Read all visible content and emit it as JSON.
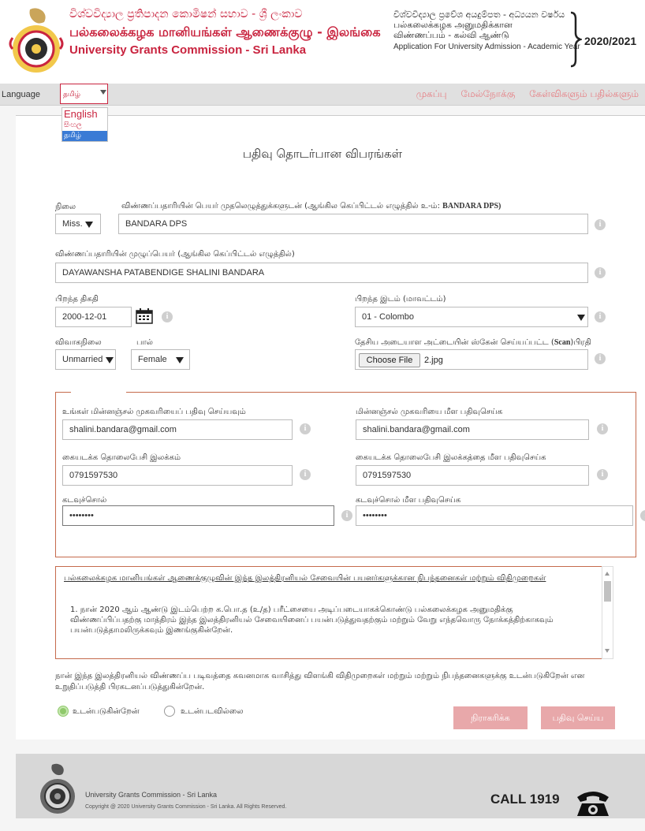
{
  "header": {
    "title_si": "විශ්වවිද්‍යාල ප්‍රතිපාදන කොමිෂන් සභාව - ශ්‍රී ලංකාව",
    "title_ta": "பல்கலைக்கழக மானியங்கள் ஆணைக்குழு - இலங்கை",
    "title_en": "University Grants Commission - Sri Lanka",
    "app_si": "විශ්වවිද්‍යාල ප්‍රවේශ අයදුම්පත - අධ්‍යයන වර්ෂය",
    "app_ta_1": "பல்கலைக்கழக அனுமதிக்கான",
    "app_ta_2": "விண்ணப்பம் - கல்வி ஆண்டு",
    "app_en": "Application For University Admission - Academic Year",
    "year": "2020/2021"
  },
  "nav": {
    "language_label": "Language",
    "language_selected": "தமிழ்",
    "language_options": [
      "English",
      "සිංහල",
      "தமிழ்"
    ],
    "links": [
      "முகப்பு",
      "மேல்நோக்கு",
      "கேள்விகளும் பதில்களும்"
    ]
  },
  "form": {
    "page_title": "பதிவு தொடர்பான விபரங்கள்",
    "title_label": "நிலை",
    "title_value": "Miss.",
    "name_initials_label": "விண்ணப்பதாரியின் பெயர் முதலெழுத்துக்களுடன் (ஆங்கில கெப்பிட்டல் எழுத்தில் உ-ம்:",
    "name_initials_example": "BANDARA DPS)",
    "name_initials_value": "BANDARA DPS",
    "fullname_label": "விண்ணப்பதாரியின் முழுப்பெயர் (ஆங்கில கெப்பிட்டல் எழுத்தில்)",
    "fullname_value": "DAYAWANSHA PATABENDIGE SHALINI BANDARA",
    "dob_label": "பிறந்த திகதி",
    "dob_value": "2000-12-01",
    "birthplace_label": "பிறந்த இடம் (மாவட்டம்)",
    "birthplace_value": "01 - Colombo",
    "marital_label": "விவாகநிலை",
    "marital_value": "Unmarried",
    "gender_label": "பால்",
    "gender_value": "Female",
    "nic_label": "தேசிய அடையாள அட்டையின் ஸ்கேன் செய்யப்பட்ட (",
    "nic_label_bold": "Scan",
    "nic_label_end": ")பிரதி",
    "choose_file": "Choose File",
    "file_name": "2.jpg",
    "email_label": "உங்கள் மின்னஞ்சல் முகவரியைப் பதிவு செய்யவும்",
    "email_value": "shalini.bandara@gmail.com",
    "email_confirm_label": "மின்னஞ்சல் முகவரியை மீள பதிவுசெய்க",
    "email_confirm_value": "shalini.bandara@gmail.com",
    "mobile_label": "கையடக்க தொலைபேசி இலக்கம்",
    "mobile_value": "0791597530",
    "mobile_confirm_label": "கையடக்க தொலைபேசி இலக்கத்தை மீள பதிவுசெய்க",
    "mobile_confirm_value": "0791597530",
    "password_label": "கடவுச்சொல்",
    "password_value": "••••••••",
    "password_confirm_label": "கடவுச்சொல் மீள பதிவுசெய்க",
    "password_confirm_value": "••••••••"
  },
  "terms": {
    "heading": "பல்கலைக்கழக மானியங்கள் ஆணைக்குழுவின் இந்த இலத்திரனியல் சேவையின் பயனர்களுக்கான நிபந்தனைகள் மற்றும் விதிமுறைகள்",
    "item_1": "1. நான் 2020 ஆம் ஆண்டு இடம்பெற்ற க.பொ.த (உ/த) பரீட்சையை அடிப்படையாகக்கொண்டு பல்கலைக்கழக அனுமதிக்கு விண்ணப்பிப்பதற்கு மாத்திரம் இந்த இலத்திரனியல் சேவையினைப் பயன்படுத்துவதற்கும் மற்றும் வேறு எந்தவொரு நோக்கத்திற்காகவும் பயன்படுத்தாமலிருக்கவும் இணங்குகின்றேன்."
  },
  "declaration": {
    "text": "நான் இந்த இலத்திரனியல் விண்ணப்ப படிவத்தை கவனமாக வாசித்து விளங்கி விதிமுறைகள் மற்றும் மற்றும் நிபந்தனைகளுக்கு உடன்படுகிறேன் என உறுதிப்படுத்தி பிரகடனப்படுத்துகின்றேன்.",
    "agree": "உடன்படுகின்றேன்",
    "disagree": "உடன்படவில்லை",
    "agree_selected": true,
    "reject_button": "நிராகரிக்க",
    "submit_button": "பதிவு செய்ய"
  },
  "footer": {
    "org": "University Grants Commission - Sri Lanka",
    "copyright": "Copyright @ 2020 University Grants Commission - Sri Lanka. All Rights Reserved.",
    "call": "CALL 1919"
  },
  "colors": {
    "brand": "#c9243f",
    "fieldset_border": "#c56a4c",
    "button": "#e8a8aa",
    "footer_bg": "#d7d7d7"
  },
  "icons": [
    "ugc-logo",
    "calendar-icon",
    "info-icon",
    "phone-icon",
    "dropdown-arrow-icon"
  ]
}
